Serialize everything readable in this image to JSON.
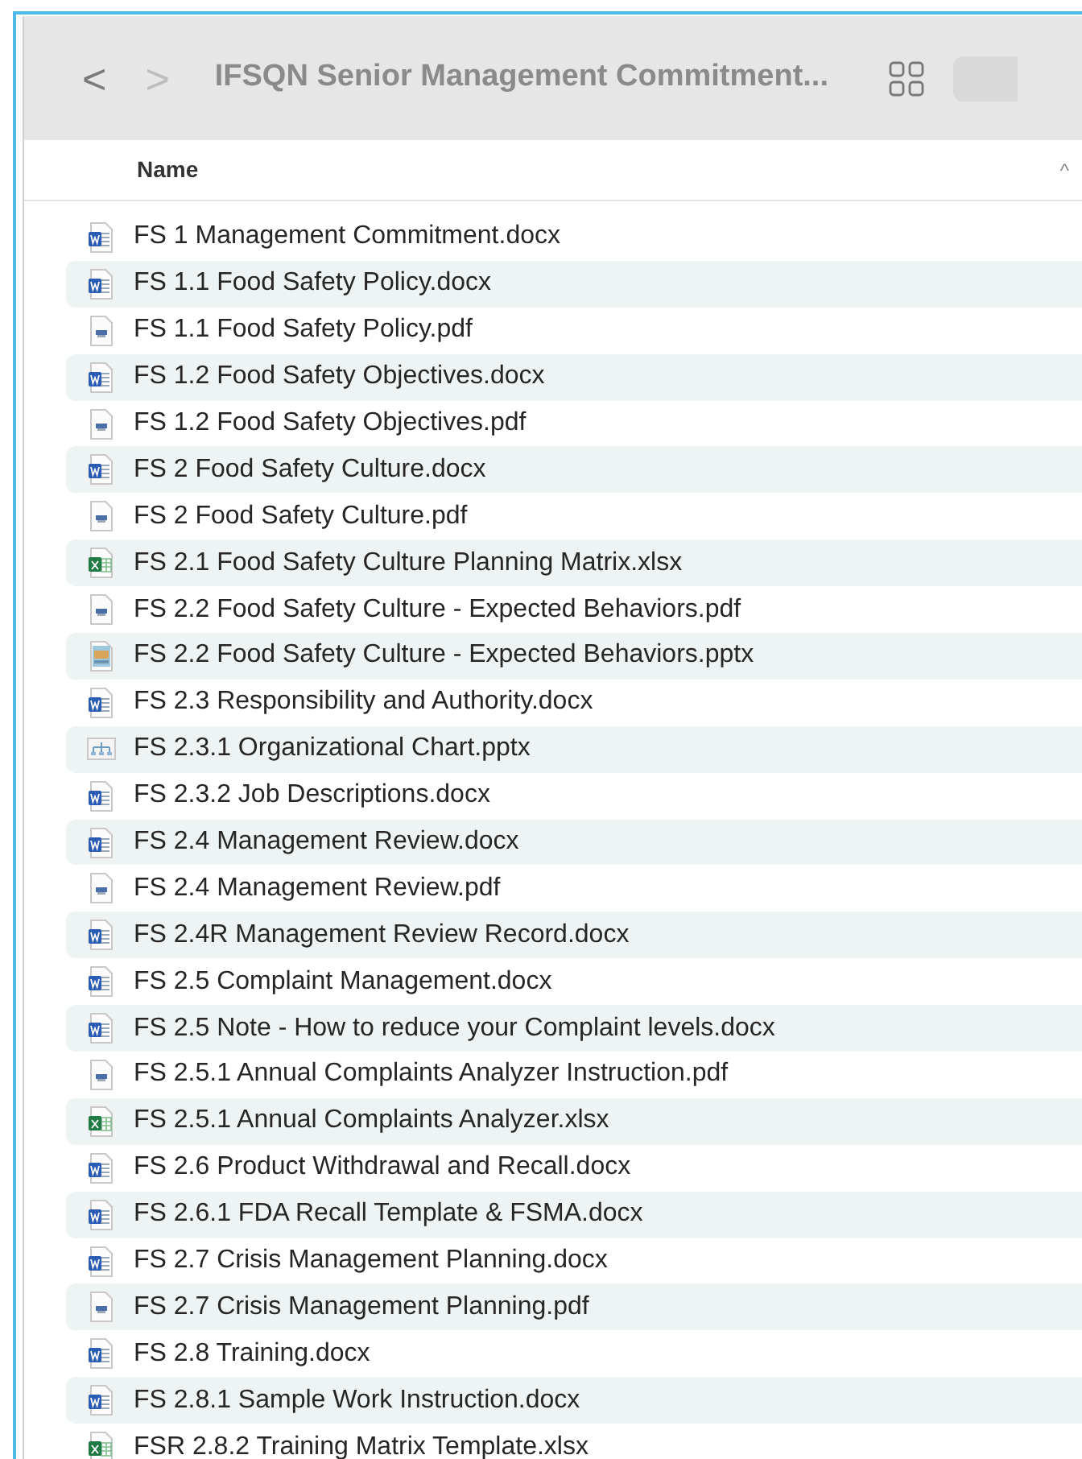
{
  "toolbar": {
    "back": "<",
    "forward": ">",
    "title": "IFSQN Senior Management Commitment..."
  },
  "header": {
    "label": "Name",
    "sort": "^"
  },
  "files": [
    {
      "name": "FS 1 Management Commitment.docx",
      "kind": "docx"
    },
    {
      "name": "FS 1.1 Food Safety Policy.docx",
      "kind": "docx"
    },
    {
      "name": "FS 1.1 Food Safety Policy.pdf",
      "kind": "pdf"
    },
    {
      "name": "FS 1.2 Food Safety Objectives.docx",
      "kind": "docx"
    },
    {
      "name": "FS 1.2 Food Safety Objectives.pdf",
      "kind": "pdf"
    },
    {
      "name": "FS 2 Food Safety Culture.docx",
      "kind": "docx"
    },
    {
      "name": "FS 2 Food Safety Culture.pdf",
      "kind": "pdf"
    },
    {
      "name": "FS 2.1 Food Safety Culture Planning Matrix.xlsx",
      "kind": "xlsx"
    },
    {
      "name": "FS 2.2 Food Safety Culture - Expected Behaviors.pdf",
      "kind": "pdf"
    },
    {
      "name": "FS 2.2 Food Safety Culture - Expected Behaviors.pptx",
      "kind": "pptx"
    },
    {
      "name": "FS 2.3 Responsibility and Authority.docx",
      "kind": "docx"
    },
    {
      "name": "FS 2.3.1 Organizational Chart.pptx",
      "kind": "orgchart"
    },
    {
      "name": "FS 2.3.2 Job Descriptions.docx",
      "kind": "docx"
    },
    {
      "name": "FS 2.4 Management Review.docx",
      "kind": "docx"
    },
    {
      "name": "FS 2.4 Management Review.pdf",
      "kind": "pdf"
    },
    {
      "name": "FS 2.4R Management Review Record.docx",
      "kind": "docx"
    },
    {
      "name": "FS 2.5 Complaint Management.docx",
      "kind": "docx"
    },
    {
      "name": "FS 2.5 Note - How to reduce your Complaint levels.docx",
      "kind": "docx"
    },
    {
      "name": "FS 2.5.1 Annual Complaints Analyzer Instruction.pdf",
      "kind": "pdf"
    },
    {
      "name": "FS 2.5.1 Annual Complaints Analyzer.xlsx",
      "kind": "xlsx"
    },
    {
      "name": "FS 2.6 Product Withdrawal and Recall.docx",
      "kind": "docx"
    },
    {
      "name": "FS 2.6.1 FDA Recall Template & FSMA.docx",
      "kind": "docx"
    },
    {
      "name": "FS 2.7 Crisis Management Planning.docx",
      "kind": "docx"
    },
    {
      "name": "FS 2.7 Crisis Management Planning.pdf",
      "kind": "pdf"
    },
    {
      "name": "FS 2.8 Training.docx",
      "kind": "docx"
    },
    {
      "name": "FS 2.8.1 Sample Work Instruction.docx",
      "kind": "docx"
    },
    {
      "name": "FSR 2.8.2 Training Matrix Template.xlsx",
      "kind": "xlsx"
    }
  ]
}
